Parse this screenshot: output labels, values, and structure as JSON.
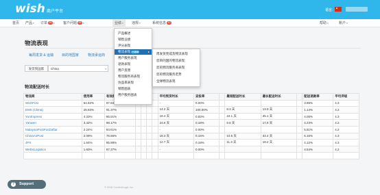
{
  "header": {
    "logo_text": "wish",
    "platform_label": "商户平台",
    "language_label": "语言:"
  },
  "nav": {
    "items": [
      {
        "label": "首页"
      },
      {
        "label": "产品",
        "caret": "▾"
      },
      {
        "label": "订单",
        "badge": "99",
        "caret": "▾"
      },
      {
        "label": "客户问题",
        "badge": "99",
        "caret": "▾"
      },
      {
        "label": "业绩",
        "caret": "▾"
      },
      {
        "label": "违规",
        "caret": "▾"
      },
      {
        "label": "系统信息",
        "badge": "10"
      }
    ],
    "right_items": [
      {
        "label": "帮助",
        "caret": "▾"
      },
      {
        "label": "账户",
        "caret": "▾"
      }
    ]
  },
  "dropdown_performance": {
    "items": [
      {
        "label": "产品概述"
      },
      {
        "label": "销售业绩"
      },
      {
        "label": "评分表现"
      },
      {
        "label": "物流表现",
        "badge": "已更新",
        "arrow": "▸"
      },
      {
        "label": "用户服务表现"
      },
      {
        "label": "退款表现"
      },
      {
        "label": "用户反馈"
      },
      {
        "label": "物流服务商表现"
      },
      {
        "label": "仿品率表现"
      },
      {
        "label": "销售图表"
      },
      {
        "label": "用户服务图表"
      }
    ]
  },
  "dropdown_logistics": {
    "items": [
      {
        "label": "周发货完成及物流表现"
      },
      {
        "label": "您目的国的物流表现"
      },
      {
        "label": "您的物流服务商表现"
      },
      {
        "label": "您的物流服务走势"
      },
      {
        "label": "全球物流表现"
      }
    ]
  },
  "page": {
    "title": "物流表现",
    "tabs": [
      {
        "label": "每周发货 & 运输"
      },
      {
        "label": "目的地国家"
      },
      {
        "label": "物流承运商"
      }
    ],
    "filter_label": "发货到国家",
    "filter_value": "China",
    "date_note": "",
    "section_title": "物流配送时长"
  },
  "table": {
    "headers": [
      "物流商",
      "使用率",
      "有效跟踪率",
      "",
      "",
      "",
      "",
      "平均到货时长",
      "妥投率",
      "",
      "最短配送时长",
      "最长配送时长",
      "",
      "配送退款率",
      "平均评级"
    ],
    "rows": [
      [
        "WishPost",
        "54.82%",
        "97.84%",
        "",
        "",
        "",
        "",
        "-",
        "0.00%",
        "",
        "",
        "",
        "",
        "3.88%",
        "4.3"
      ],
      [
        "EMS (China)",
        "25.83%",
        "91.37%",
        "",
        "",
        "",
        "",
        "14.2 天",
        "100.00%",
        "",
        "8.3 天",
        "13.9 天",
        "",
        "1.14%",
        "4.2"
      ],
      [
        "YunExpress",
        "4.33%",
        "96.91%",
        "",
        "",
        "",
        "",
        "18.4 天",
        "0.83%",
        "",
        "16.1 天",
        "35.1 天",
        "",
        "4.05%",
        "4.3"
      ],
      [
        "Yanwen",
        "3.42%",
        "98.17%",
        "",
        "",
        "",
        "",
        "24.6 天",
        "0.18%",
        "",
        "9.6 天",
        "17.6 天",
        "",
        "4.23%",
        "4.2"
      ],
      [
        "MalaysiaPostPosDaftar",
        "2.24%",
        "94.61%",
        "",
        "",
        "",
        "",
        "-",
        "0.00%",
        "",
        "",
        "",
        "",
        "5.81%",
        "4.2"
      ],
      [
        "ChinaAirPost",
        "2.09%",
        "78.66%",
        "",
        "",
        "",
        "",
        "18.3 天",
        "0.15%",
        "",
        "10.5 天",
        "33.4 天",
        "",
        "5.16%",
        "4.3"
      ],
      [
        "4PX",
        "1.64%",
        "85.88%",
        "",
        "",
        "",
        "",
        "12.7 天",
        "0.18%",
        "",
        "11.3 天",
        "18.2 天",
        "",
        "4.12%",
        "4.3"
      ],
      [
        "WeDoLogistics",
        "1.60%",
        "97.37%",
        "",
        "",
        "",
        "",
        "-",
        "0.00%",
        "",
        "",
        "",
        "",
        "4.54%",
        "4.2"
      ],
      [
        "",
        "",
        "",
        "",
        "",
        "",
        "",
        "",
        "",
        "",
        "",
        "",
        "",
        "",
        ""
      ]
    ]
  },
  "footer": {
    "text": "",
    "copyright": "© 2018 ContextLogic Inc."
  },
  "support": {
    "icon_label": "?",
    "label": "Support"
  },
  "colors": {
    "topbar": "#2fb7ec",
    "link": "#2b7fc0",
    "menu_selected": "#1f6fb2",
    "badge": "#e74c3c",
    "support_button": "#546e7a"
  }
}
